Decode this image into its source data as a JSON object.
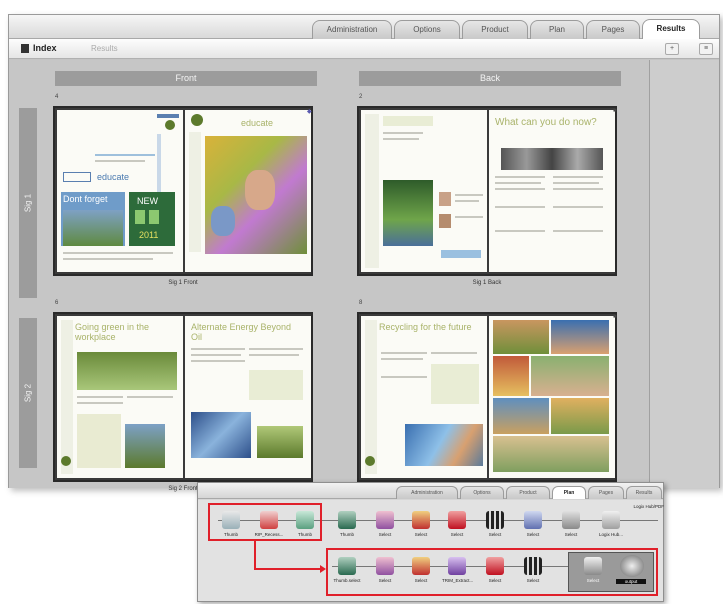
{
  "tabs": [
    "Administration",
    "Options",
    "Product",
    "Plan",
    "Pages",
    "Results"
  ],
  "active_tab": "Results",
  "toolbar": {
    "doc_label": "Index",
    "secondary_label": "Results"
  },
  "columns": {
    "front": "Front",
    "back": "Back"
  },
  "rows": {
    "sig1": "Sig 1",
    "sig2": "Sig 2"
  },
  "captions": {
    "sig1_front": "Sig 1 Front",
    "sig1_back": "Sig 1 Back",
    "sig2_front": "Sig 2 Front"
  },
  "page_text": {
    "p1_brand": "educate",
    "p1_headline": "Dont forget",
    "p1_big": "NEW",
    "p1_year": "2011",
    "p2_brand": "educate",
    "p3_title": "What can you do now?",
    "p5_title": "Going green in the workplace",
    "p6_title": "Alternate Energy Beyond Oil",
    "p7_title": "Recycling for the future"
  },
  "flow": {
    "tabs": [
      "Administration",
      "Options",
      "Product",
      "Plan",
      "Pages",
      "Results"
    ],
    "active_tab": "Plan",
    "top_nodes": [
      "Thumb",
      "RIP_Recess...",
      "Thumb",
      "Thumb",
      "Select",
      "Select",
      "Select",
      "Select",
      "Select",
      "Select",
      "Logix Hub..."
    ],
    "bottom_nodes": [
      "Thumb.select",
      "Select",
      "Select",
      "TRIM_Extract...",
      "Select",
      "Select",
      "Select",
      "Select"
    ],
    "top_right_label": "Logix Hub/PDF",
    "badge_label": "output"
  },
  "colors": {
    "accent_red": "#e0202a",
    "header_gray": "#9c9c9c",
    "title_green": "#a9b36a"
  }
}
